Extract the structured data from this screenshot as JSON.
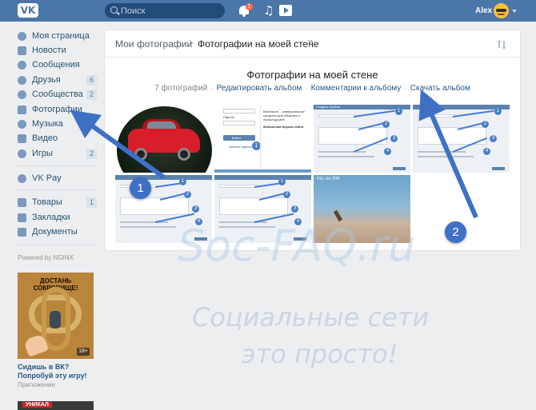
{
  "header": {
    "logo": "VK",
    "search_placeholder": "Поиск",
    "notifications_count": "1",
    "user_name": "Alex"
  },
  "sidebar": {
    "items": [
      {
        "label": "Моя страница",
        "badge": ""
      },
      {
        "label": "Новости",
        "badge": ""
      },
      {
        "label": "Сообщения",
        "badge": ""
      },
      {
        "label": "Друзья",
        "badge": "6"
      },
      {
        "label": "Сообщества",
        "badge": "2"
      },
      {
        "label": "Фотографии",
        "badge": ""
      },
      {
        "label": "Музыка",
        "badge": ""
      },
      {
        "label": "Видео",
        "badge": ""
      },
      {
        "label": "Игры",
        "badge": "2"
      },
      {
        "label": "VK Pay",
        "badge": ""
      },
      {
        "label": "Товары",
        "badge": "1"
      },
      {
        "label": "Закладки",
        "badge": ""
      },
      {
        "label": "Документы",
        "badge": ""
      }
    ],
    "powered_by": "Powered by NGINX",
    "ad": {
      "image_title": "ДОСТАНЬ СОКРОВИЩЕ!",
      "age": "18+",
      "title": "Сидишь в ВК? Попробуй эту игру!",
      "subtitle": "Приложение",
      "second_ad_label": "УНИКАЛ"
    }
  },
  "breadcrumbs": {
    "root": "Мои фотографии",
    "current": "Фотографии на моей стене",
    "count": "7"
  },
  "album": {
    "title": "Фотографии на моей стене",
    "photo_count": "7 фотографий",
    "links": [
      "Редактировать альбом",
      "Комментарии к альбому",
      "Скачать альбом"
    ]
  },
  "thumbnails": {
    "login_labels": {
      "password": "Пароль",
      "button": "Войти",
      "forgot": "Забыли пароль?",
      "vk_text": "ВКонтакте – универсальное средство для общения и поиска друзей",
      "mobile": "Мобильная версия сайта"
    },
    "dialog_header": "Создать альбом",
    "beach_label": "Ma vie BM"
  },
  "annotations": {
    "badge_1": "1",
    "badge_2": "2",
    "watermark_line1": "Soc-FAQ.ru",
    "watermark_line2": "Социальные сети",
    "watermark_line3": "это просто!"
  },
  "colors": {
    "header": "#4a76a8",
    "link": "#2a5885",
    "annotation": "#3e70c6"
  }
}
